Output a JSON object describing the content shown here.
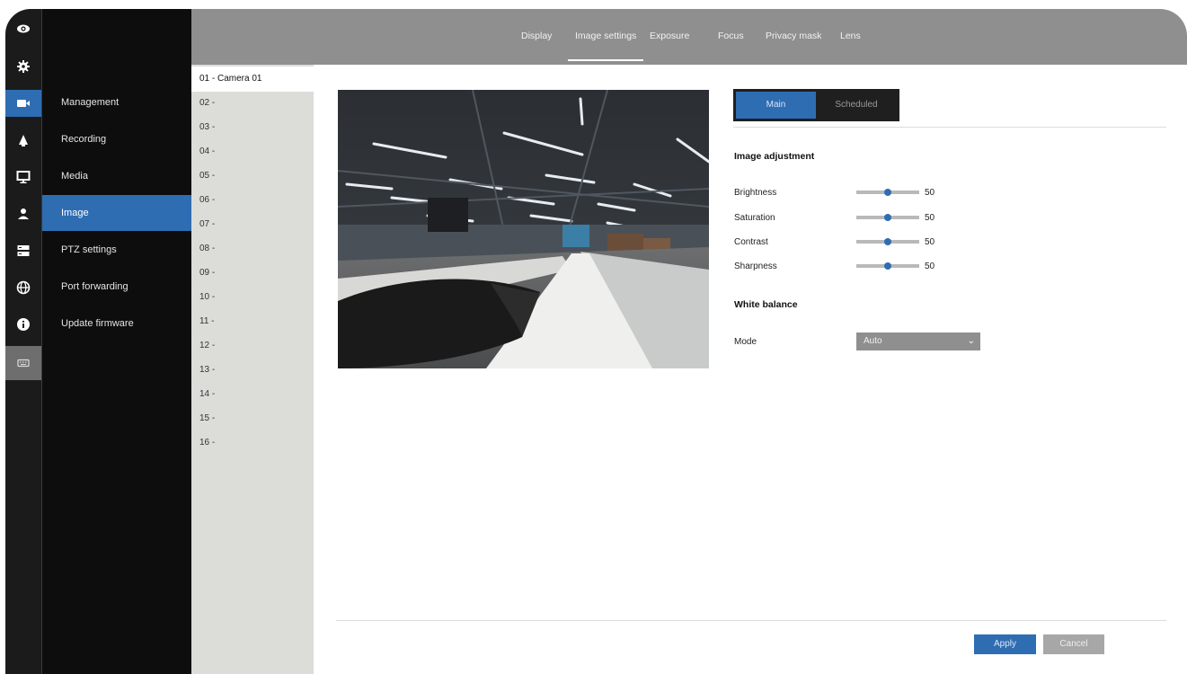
{
  "rail": {
    "items": [
      {
        "icon": "eye-icon"
      },
      {
        "icon": "gear-icon"
      },
      {
        "icon": "video-camera-icon",
        "active": true
      },
      {
        "icon": "alert-bell-icon"
      },
      {
        "icon": "monitor-icon"
      },
      {
        "icon": "user-icon"
      },
      {
        "icon": "storage-icon"
      },
      {
        "icon": "globe-icon"
      },
      {
        "icon": "info-icon"
      },
      {
        "icon": "keyboard-icon"
      }
    ]
  },
  "menu": {
    "items": [
      {
        "label": "Management"
      },
      {
        "label": "Recording"
      },
      {
        "label": "Media"
      },
      {
        "label": "Image",
        "active": true
      },
      {
        "label": "PTZ settings"
      },
      {
        "label": "Port forwarding"
      },
      {
        "label": "Update firmware"
      }
    ]
  },
  "tabs": [
    {
      "label": "Display"
    },
    {
      "label": "Image settings",
      "active": true
    },
    {
      "label": "Exposure"
    },
    {
      "label": "Focus"
    },
    {
      "label": "Privacy mask"
    },
    {
      "label": "Lens"
    }
  ],
  "cameras": [
    {
      "label": "01 - Camera 01",
      "active": true
    },
    {
      "label": "02 -"
    },
    {
      "label": "03 -"
    },
    {
      "label": "04 -"
    },
    {
      "label": "05 -"
    },
    {
      "label": "06 -"
    },
    {
      "label": "07 -"
    },
    {
      "label": "08 -"
    },
    {
      "label": "09 -"
    },
    {
      "label": "10 -"
    },
    {
      "label": "11 -"
    },
    {
      "label": "12 -"
    },
    {
      "label": "13 -"
    },
    {
      "label": "14 -"
    },
    {
      "label": "15 -"
    },
    {
      "label": "16 -"
    }
  ],
  "panel": {
    "segment": {
      "main": "Main",
      "scheduled": "Scheduled"
    },
    "image_adjustment_title": "Image adjustment",
    "adjustments": [
      {
        "label": "Brightness",
        "value": "50",
        "fraction": 0.5
      },
      {
        "label": "Saturation",
        "value": "50",
        "fraction": 0.5
      },
      {
        "label": "Contrast",
        "value": "50",
        "fraction": 0.5
      },
      {
        "label": "Sharpness",
        "value": "50",
        "fraction": 0.5
      }
    ],
    "white_balance_title": "White balance",
    "mode_label": "Mode",
    "mode_value": "Auto"
  },
  "footer": {
    "apply": "Apply",
    "cancel": "Cancel"
  },
  "colors": {
    "accent": "#2f6db3",
    "topbar": "#8f8f8f",
    "menu_bg": "#0d0d0d"
  }
}
